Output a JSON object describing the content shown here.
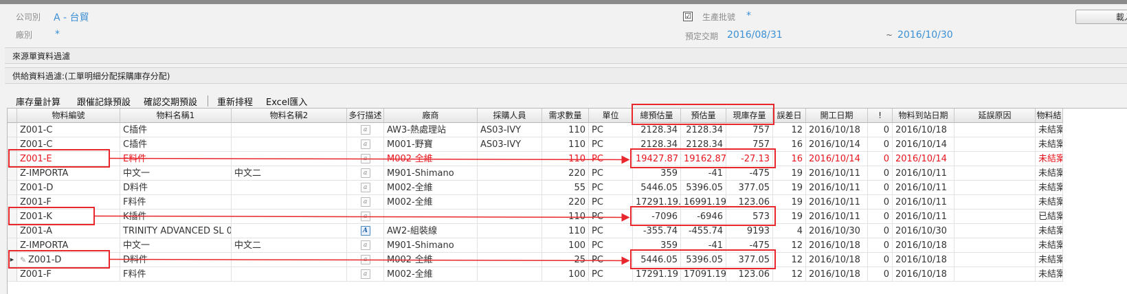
{
  "filter": {
    "company_label": "公司別",
    "company_value": "A - 台貿",
    "plant_label": "廠別",
    "plant_value": "*",
    "batch_checked": "☑",
    "batch_label": "生產批號",
    "batch_value": "*",
    "due_label": "預定交期",
    "due_from": "2016/08/31",
    "due_sep": "~",
    "due_to": "2016/10/30",
    "load_button": "載入"
  },
  "sections": {
    "source_filter": "來源單資料過濾",
    "supply_filter": "供給資料過濾:(工單明細分配採購庫存分配)"
  },
  "toolbar": {
    "stock_calc": "庫存量計算",
    "followup_preset": "跟催記錄預設",
    "confirm_due_preset": "確認交期預設",
    "reschedule": "重新排程",
    "excel_import": "Excel匯入"
  },
  "grid": {
    "columns": [
      "物料編號",
      "物料名稱1",
      "物料名稱2",
      "多行描述",
      "廠商",
      "採購人員",
      "需求數量",
      "單位",
      "總預估量",
      "預估量",
      "現庫存量",
      "誤差日",
      "開工日期",
      "!",
      "物料到站日期",
      "延誤原因",
      "物料結"
    ],
    "rows": [
      {
        "code": "Z001-C",
        "name1": "C插件",
        "name2": "",
        "desc": "a",
        "vendor": "AW3-熱處理站",
        "buyer": "AS03-IVY",
        "qty": "110",
        "unit": "PC",
        "total_est": "2128.34",
        "est": "2128.34",
        "stock": "757",
        "diff": "12",
        "start": "2016/10/18",
        "flag": "0",
        "arrive": "2016/10/18",
        "reason": "",
        "status": "未結案"
      },
      {
        "code": "Z001-C",
        "name1": "C插件",
        "name2": "",
        "desc": "a",
        "vendor": "M001-野寶",
        "buyer": "AS03-IVY",
        "qty": "110",
        "unit": "PC",
        "total_est": "2128.34",
        "est": "2128.34",
        "stock": "757",
        "diff": "16",
        "start": "2016/10/14",
        "flag": "0",
        "arrive": "2016/10/14",
        "reason": "",
        "status": "未結案"
      },
      {
        "code": "Z001-E",
        "name1": "E料件",
        "name2": "",
        "desc": "a",
        "vendor": "M002-全維",
        "buyer": "",
        "qty": "110",
        "unit": "PC",
        "total_est": "19427.87",
        "est": "19162.87",
        "stock": "-27.13",
        "diff": "16",
        "start": "2016/10/14",
        "flag": "0",
        "arrive": "2016/10/14",
        "reason": "",
        "status": "未結案",
        "highlight": "red"
      },
      {
        "code": "Z-IMPORTA",
        "name1": "中文一",
        "name2": "中文二",
        "desc": "a",
        "vendor": "M901-Shimano",
        "buyer": "",
        "qty": "220",
        "unit": "PC",
        "total_est": "359",
        "est": "-41",
        "stock": "-475",
        "diff": "19",
        "start": "2016/10/11",
        "flag": "0",
        "arrive": "2016/10/11",
        "reason": "",
        "status": "未結案"
      },
      {
        "code": "Z001-D",
        "name1": "D料件",
        "name2": "",
        "desc": "a",
        "vendor": "M002-全維",
        "buyer": "",
        "qty": "55",
        "unit": "PC",
        "total_est": "5446.05",
        "est": "5396.05",
        "stock": "377.05",
        "diff": "19",
        "start": "2016/10/11",
        "flag": "0",
        "arrive": "2016/10/11",
        "reason": "",
        "status": "未結案"
      },
      {
        "code": "Z001-F",
        "name1": "F料件",
        "name2": "",
        "desc": "a",
        "vendor": "M002-全維",
        "buyer": "",
        "qty": "220",
        "unit": "PC",
        "total_est": "17291.19...",
        "est": "16991.19...",
        "stock": "123.06",
        "diff": "19",
        "start": "2016/10/11",
        "flag": "0",
        "arrive": "2016/10/11",
        "reason": "",
        "status": "未結案"
      },
      {
        "code": "Z001-K",
        "name1": "K插件",
        "name2": "",
        "desc": "a",
        "vendor": "",
        "buyer": "",
        "qty": "110",
        "unit": "PC",
        "total_est": "-7096",
        "est": "-6946",
        "stock": "573",
        "diff": "19",
        "start": "2016/10/11",
        "flag": "0",
        "arrive": "2016/10/11",
        "reason": "",
        "status": "已結案"
      },
      {
        "code": "Z001-A",
        "name1": "TRINITY ADVANCED SL 0",
        "name2": "",
        "desc": "A",
        "desc_active": true,
        "vendor": "AW2-組裝線",
        "buyer": "",
        "qty": "110",
        "unit": "PC",
        "total_est": "-355.74",
        "est": "-455.74",
        "stock": "9193",
        "diff": "4",
        "start": "2016/10/30",
        "flag": "0",
        "arrive": "2016/10/30",
        "reason": "",
        "status": "未結案"
      },
      {
        "code": "Z-IMPORTA",
        "name1": "中文一",
        "name2": "中文二",
        "desc": "a",
        "vendor": "M901-Shimano",
        "buyer": "",
        "qty": "100",
        "unit": "PC",
        "total_est": "359",
        "est": "-41",
        "stock": "-475",
        "diff": "12",
        "start": "2016/10/18",
        "flag": "0",
        "arrive": "2016/10/18",
        "reason": "",
        "status": "未結案"
      },
      {
        "code": "Z001-D",
        "name1": "D料件",
        "name2": "",
        "desc": "a",
        "vendor": "M002-全維",
        "buyer": "",
        "qty": "25",
        "unit": "PC",
        "total_est": "5446.05",
        "est": "5396.05",
        "stock": "377.05",
        "diff": "12",
        "start": "2016/10/18",
        "flag": "0",
        "arrive": "2016/10/18",
        "reason": "",
        "status": "未結案",
        "current": true
      },
      {
        "code": "Z001-F",
        "name1": "F料件",
        "name2": "",
        "desc": "a",
        "vendor": "M002-全維",
        "buyer": "",
        "qty": "100",
        "unit": "PC",
        "total_est": "17291.19",
        "est": "17091.19",
        "stock": "123.06",
        "diff": "12",
        "start": "2016/10/18",
        "flag": "0",
        "arrive": "2016/10/18",
        "reason": "",
        "status": "未結案"
      }
    ]
  },
  "colors": {
    "accent": "#3a8fd6",
    "highlight_red": "#e8141c",
    "annotation": "#e8262c"
  }
}
